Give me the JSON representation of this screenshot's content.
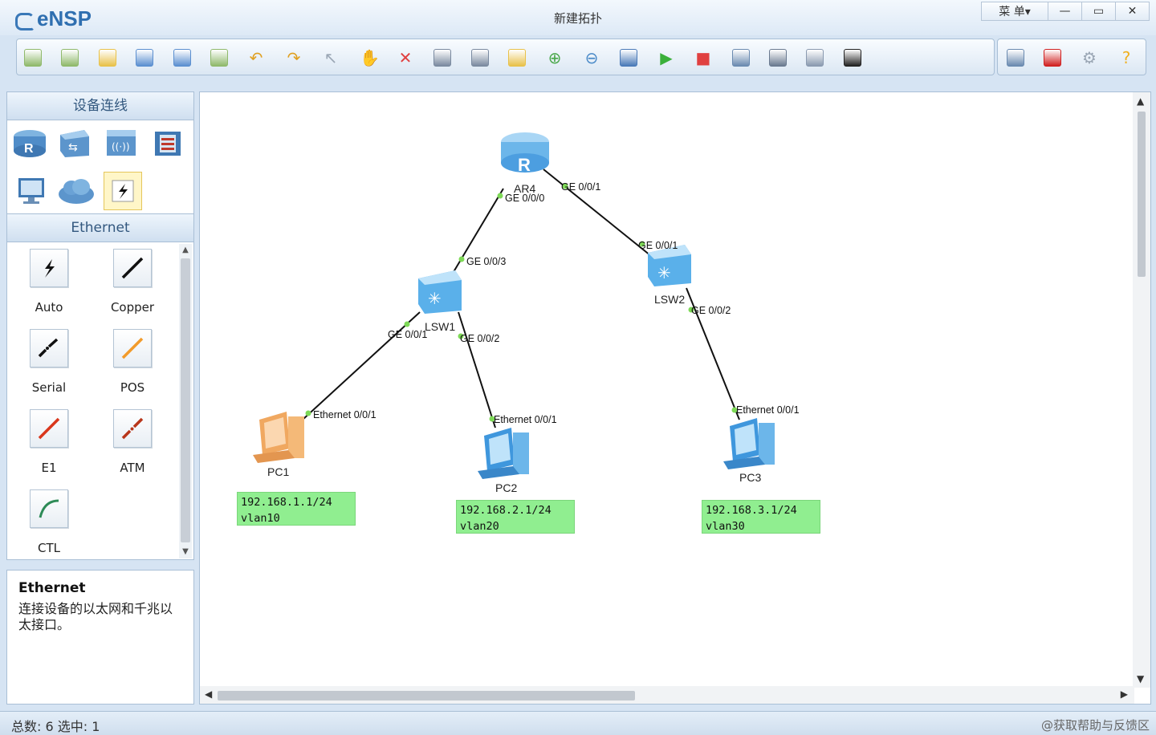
{
  "app": {
    "logo": "eNSP",
    "window_title": "新建拓扑",
    "menu_label": "菜 单▾"
  },
  "window_controls": {
    "minimize": "—",
    "maximize": "▭",
    "close": "✕"
  },
  "toolbar": {
    "buttons": [
      "new-topology-icon",
      "new-device-icon",
      "open-icon",
      "save-icon",
      "save-as-icon",
      "print-icon",
      "undo-icon",
      "redo-icon",
      "select-icon",
      "pan-hand-icon",
      "delete-icon",
      "delete-link-icon",
      "text-note-icon",
      "rectangle-icon",
      "zoom-in-icon",
      "zoom-out-icon",
      "fit-view-icon",
      "start-icon",
      "stop-icon",
      "capture-icon",
      "topology-icon",
      "grid-icon",
      "console-icon"
    ],
    "right_buttons": [
      "chat-icon",
      "huawei-logo-icon",
      "settings-icon",
      "help-icon"
    ]
  },
  "left_panel": {
    "devices_header": "设备连线",
    "device_icons": [
      "router-icon",
      "switch-icon",
      "wlan-icon",
      "firewall-icon",
      "pc-icon",
      "cloud-icon",
      "cable-icon"
    ],
    "cables_header": "Ethernet",
    "cables": [
      {
        "label": "Auto",
        "icon": "auto-cable-icon"
      },
      {
        "label": "Copper",
        "icon": "copper-cable-icon"
      },
      {
        "label": "Serial",
        "icon": "serial-cable-icon"
      },
      {
        "label": "POS",
        "icon": "pos-cable-icon"
      },
      {
        "label": "E1",
        "icon": "e1-cable-icon"
      },
      {
        "label": "ATM",
        "icon": "atm-cable-icon"
      },
      {
        "label": "CTL",
        "icon": "ctl-cable-icon"
      }
    ],
    "description": {
      "title": "Ethernet",
      "text": "连接设备的以太网和千兆以太接口。"
    }
  },
  "topology": {
    "nodes": {
      "ar4": "AR4",
      "lsw1": "LSW1",
      "lsw2": "LSW2",
      "pc1": "PC1",
      "pc2": "PC2",
      "pc3": "PC3"
    },
    "ports": {
      "ar4_lsw1": "GE 0/0/0",
      "ar4_lsw2": "GE 0/0/1",
      "lsw1_ar4": "GE 0/0/3",
      "lsw1_pc1": "GE 0/0/1",
      "lsw1_pc2": "GE 0/0/2",
      "lsw2_ar4": "GE 0/0/1",
      "lsw2_pc3": "GE 0/0/2",
      "pc1_port": "Ethernet 0/0/1",
      "pc2_port": "Ethernet 0/0/1",
      "pc3_port": "Ethernet 0/0/1"
    },
    "notes": {
      "pc1": "192.168.1.1/24\nvlan10",
      "pc2": "192.168.2.1/24\nvlan20",
      "pc3": "192.168.3.1/24\nvlan30"
    }
  },
  "status": {
    "left": "总数: 6 选中: 1",
    "right": "@获取帮助与反馈区"
  },
  "colors": {
    "accent": "#2f6fb0",
    "note_bg": "#90ee90",
    "link": "#111111",
    "port_dot": "#7ed957"
  }
}
